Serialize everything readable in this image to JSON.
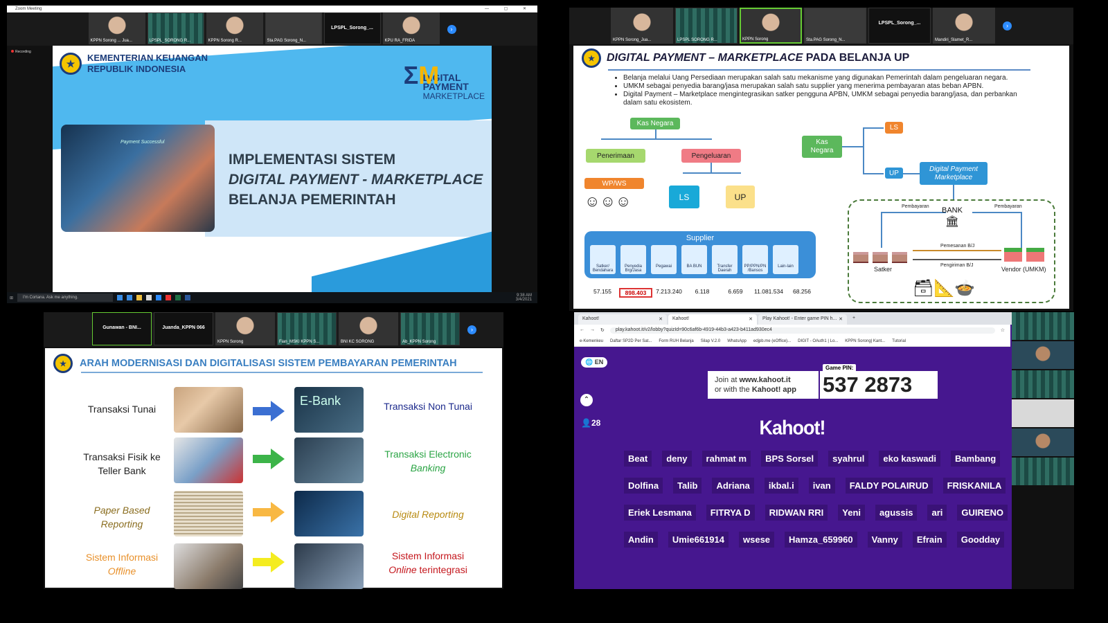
{
  "q1": {
    "window_title": "Zoom Meeting",
    "window_controls": "— ▢ ✕",
    "participants": [
      "KPPN Sorong ... Jua...",
      "LPSPL_SORONG R...",
      "KPPN Sorong R...",
      "Sta.PAG Sorong_N...",
      "LPSPL_Sorong_...",
      "KPU RA_FRIDA"
    ],
    "recording": "Recording",
    "slide": {
      "ministry_line1": "KEMENTERIAN KEUANGAN",
      "ministry_line2": "REPUBLIK INDONESIA",
      "logo_line1": "DIGITAL",
      "logo_line2": "PAYMENT",
      "logo_line3": "MARKETPLACE",
      "photo_text": "Payment Successful",
      "title_line1": "IMPLEMENTASI SISTEM",
      "title_line2": "DIGITAL PAYMENT - MARKETPLACE",
      "title_line3": "BELANJA PEMERINTAH"
    },
    "taskbar": {
      "search": "I'm Cortana. Ask me anything.",
      "time": "9:38 AM",
      "date": "3/4/2021"
    }
  },
  "q2": {
    "participants": [
      "KPPN Sorong_Jua...",
      "LPSPL SORONG R...",
      "KPPN Sorong",
      "Sta.PAG Sorong_N...",
      "LPSPL_Sorong_...",
      "Mandiri_Slamet_R..."
    ],
    "slide": {
      "title_italic": "DIGITAL PAYMENT – MARKETPLACE",
      "title_rest": " PADA BELANJA UP",
      "bullet1": "Belanja melalui Uang Persediaan merupakan salah satu mekanisme yang digunakan Pemerintah dalam pengeluaran negara.",
      "bullet2": "UMKM sebagai penyedia barang/jasa merupakan salah satu supplier yang menerima pembayaran atas beban APBN.",
      "bullet3": "Digital Payment – Marketplace mengintegrasikan satker pengguna APBN, UMKM sebagai penyedia barang/jasa, dan perbankan dalam satu ekosistem.",
      "kas_negara": "Kas Negara",
      "penerimaan": "Penerimaan",
      "pengeluaran": "Pengeluaran",
      "wpws": "WP/WS",
      "ls": "LS",
      "up": "UP",
      "supplier": "Supplier",
      "supplier_items": [
        "Satker/ Bendahara",
        "Penyedia Brg/Jasa",
        "Pegawai",
        "BA BUN",
        "Transfer Daerah",
        "PP/PPN/PN /Bansos",
        "Lain-lain"
      ],
      "values": [
        "57.155",
        "898.403",
        "7.213.240",
        "6.118",
        "6.659",
        "11.081.534",
        "68.256"
      ],
      "kas_negara2_line1": "Kas",
      "kas_negara2_line2": "Negara",
      "ls2": "LS",
      "up2": "UP",
      "dpm_line1": "Digital Payment",
      "dpm_line2": "Marketplace",
      "pembayaran1": "Pembayaran",
      "pembayaran2": "Pembayaran",
      "bank": "BANK",
      "pemesanan": "Pemesanan B/J",
      "pengiriman": "Pengiriman B/J",
      "satker": "Satker",
      "vendor": "Vendor (UMKM)"
    }
  },
  "q3": {
    "participants": [
      "Gunawan - BNI...",
      "Juanda_KPPN 066",
      "KPPN Sorong",
      "Fian_MSKI KPPN S...",
      "BNI KC SORONG",
      "Ab_KPPN Sorong"
    ],
    "slide": {
      "title": "ARAH MODERNISASI DAN DIGITALISASI SISTEM PEMBAYARAN PEMERINTAH",
      "rows": [
        {
          "left": "Transaksi Tunai",
          "right": "Transaksi Non Tunai",
          "img_text": "E-Bank"
        },
        {
          "left_line1": "Transaksi Fisik ke",
          "left_line2": "Teller Bank",
          "right_line1": "Transaksi Electronic",
          "right_line2": "Banking"
        },
        {
          "left_line1": "Paper Based",
          "left_line2": "Reporting",
          "right": "Digital Reporting"
        },
        {
          "left_line1": "Sistem Informasi",
          "left_line2": "Offline",
          "right_line1": "Sistem Informasi",
          "right_line2_a": "Online",
          "right_line2_b": " terintegrasi"
        }
      ]
    }
  },
  "q4": {
    "tabs": [
      "Kahoot!",
      "Kahoot!",
      "Play Kahoot! - Enter game PIN h..."
    ],
    "new_tab": "+",
    "url": "play.kahoot.it/v2/lobby?quizId=90c6af6b-4919-44b3-a423-b411ad930ec4",
    "bookmarks": [
      "e-Kemenkeu",
      "Daftar SP2D Per Sat...",
      "Form RUH Belanja",
      "Silap V.2.0",
      "WhatsApp",
      "edjpb.me (eOffice)...",
      "DIGIT - OAuth1 | Lo...",
      "KPPN Sorong| Kant...",
      "Tutorial"
    ],
    "lang": "EN",
    "join_line1_pre": "Join at ",
    "join_url": "www.kahoot.it",
    "join_line2_pre": "or with the ",
    "join_app": "Kahoot! app",
    "pin_label": "Game PIN:",
    "pin": "537 2873",
    "player_count": "28",
    "logo": "Kahoot!",
    "players": [
      "Beat",
      "deny",
      "rahmat m",
      "BPS Sorsel",
      "syahrul",
      "eko kaswadi",
      "Bambang",
      "Dolfina",
      "Talib",
      "Adriana",
      "ikbal.i",
      "ivan",
      "FALDY POLAIRUD",
      "FRISKANILA",
      "Eriek Lesmana",
      "FITRYA D",
      "RIDWAN RRI",
      "Yeni",
      "agussis",
      "ari",
      "GUIRENO",
      "Andin",
      "Umie661914",
      "wsese",
      "Hamza_659960",
      "Vanny",
      "Efrain",
      "Goodday"
    ]
  }
}
